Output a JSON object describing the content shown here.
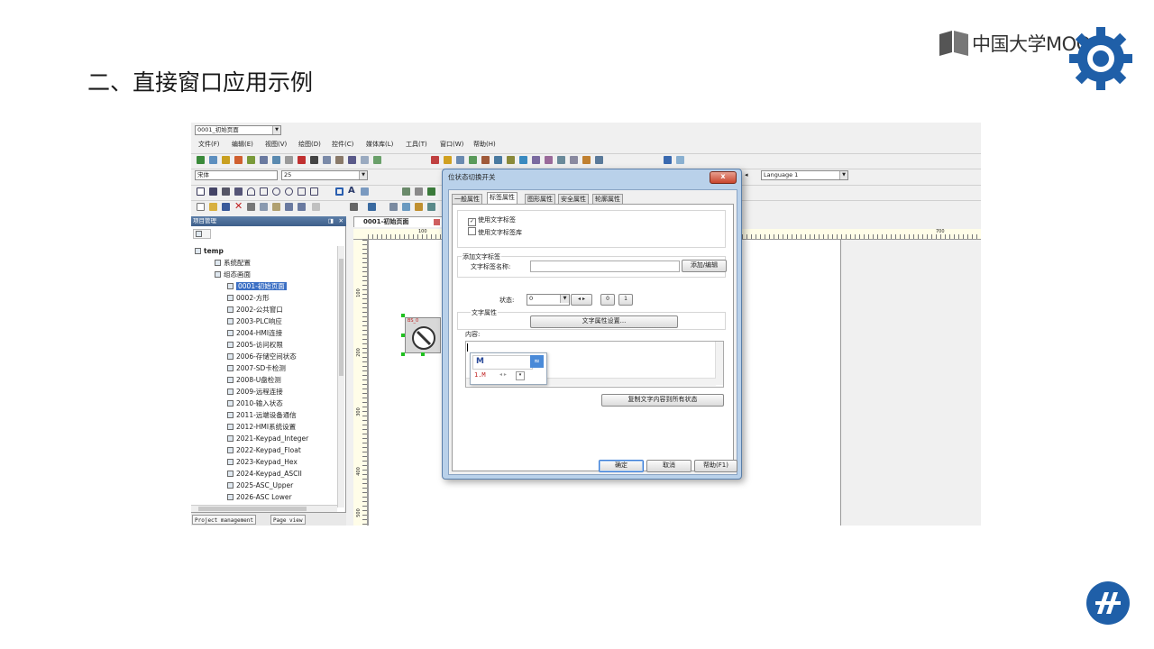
{
  "slide": {
    "title": "二、直接窗口应用示例",
    "mooc_text": "中国大学MOOC"
  },
  "app": {
    "page_selector": "0001_初始页面",
    "menu": [
      "文件(F)",
      "编辑(E)",
      "视图(V)",
      "绘图(D)",
      "控件(C)",
      "媒体库(L)",
      "工具(T)",
      "窗口(W)",
      "帮助(H)"
    ],
    "font_name": "宋体",
    "font_size": "25",
    "language": "Language 1",
    "panel_title": "项目管理",
    "tree": [
      {
        "label": "temp",
        "level": 0,
        "bold": true
      },
      {
        "label": "系统配置",
        "level": 1
      },
      {
        "label": "组态画面",
        "level": 1
      },
      {
        "label": "0001-初始页面",
        "level": 2,
        "selected": true
      },
      {
        "label": "0002-方形",
        "level": 2
      },
      {
        "label": "2002-公共窗口",
        "level": 2
      },
      {
        "label": "2003-PLC响应",
        "level": 2
      },
      {
        "label": "2004-HMI连接",
        "level": 2
      },
      {
        "label": "2005-访问权限",
        "level": 2
      },
      {
        "label": "2006-存储空间状态",
        "level": 2
      },
      {
        "label": "2007-SD卡检测",
        "level": 2
      },
      {
        "label": "2008-U盘检测",
        "level": 2
      },
      {
        "label": "2009-远程连接",
        "level": 2
      },
      {
        "label": "2010-输入状态",
        "level": 2
      },
      {
        "label": "2011-远端设备通信",
        "level": 2
      },
      {
        "label": "2012-HMI系统设置",
        "level": 2
      },
      {
        "label": "2021-Keypad_Integer",
        "level": 2
      },
      {
        "label": "2022-Keypad_Float",
        "level": 2
      },
      {
        "label": "2023-Keypad_Hex",
        "level": 2
      },
      {
        "label": "2024-Keypad_ASCII",
        "level": 2
      },
      {
        "label": "2025-ASC_Upper",
        "level": 2
      },
      {
        "label": "2026-ASC Lower",
        "level": 2
      }
    ],
    "bottom_tabs": [
      "Project management",
      "Page view"
    ],
    "canvas_tab": "0001-初始页面",
    "ruler_marks": [
      "100",
      "700",
      "800"
    ],
    "ruler_v_marks": [
      "100",
      "200",
      "300",
      "400",
      "500"
    ],
    "object_label": "BS_0"
  },
  "dialog": {
    "title": "位状态切换开关",
    "close_glyph": "x",
    "tabs": [
      "一般属性",
      "标签属性",
      "图形属性",
      "安全属性",
      "轮廓属性"
    ],
    "use_text_label": "使用文字标签",
    "use_text_label_lib": "使用文字标签库",
    "add_text_label_group": "添加文字标签",
    "text_label_name": "文字标签名称:",
    "add_edit_button": "添加/编辑",
    "state_label": "状态:",
    "state_value": "0",
    "state_btn_zero": "0",
    "state_btn_one": "1",
    "text_props_group": "文字属性",
    "text_props_button": "文字属性设置...",
    "content_label": "内容:",
    "ime_input": "M",
    "ime_candidate": "1.M",
    "copy_button": "复制文字内容到所有状态",
    "ok_button": "确定",
    "cancel_button": "取消",
    "help_button": "帮助(F1)"
  }
}
